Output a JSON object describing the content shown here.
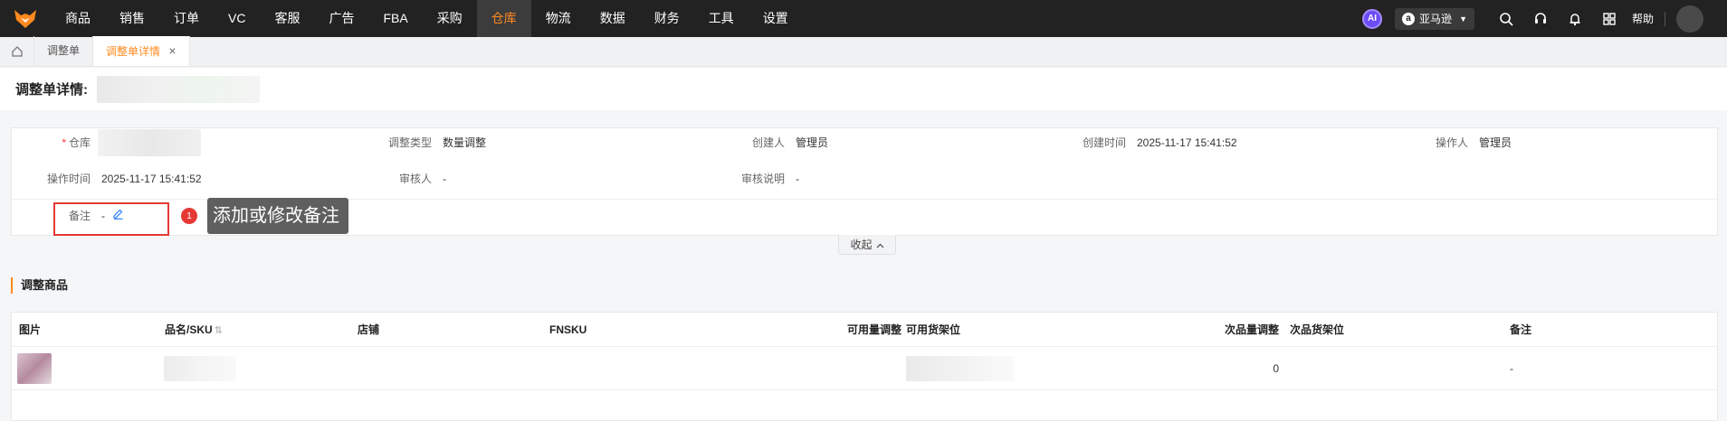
{
  "nav": {
    "menu": [
      "商品",
      "销售",
      "订单",
      "VC",
      "客服",
      "广告",
      "FBA",
      "采购",
      "仓库",
      "物流",
      "数据",
      "财务",
      "工具",
      "设置"
    ],
    "active_index": 8,
    "ai_label": "AI",
    "site_label": "亚马逊",
    "help_label": "帮助",
    "icons": [
      "search-icon",
      "headset-icon",
      "bell-icon",
      "apps-grid-icon"
    ]
  },
  "tabs": {
    "items": [
      {
        "label": "调整单",
        "active": false
      },
      {
        "label": "调整单详情",
        "active": true
      }
    ]
  },
  "header": {
    "title": "调整单详情:"
  },
  "info": {
    "warehouse_label": "仓库",
    "adjust_type_label": "调整类型",
    "adjust_type_value": "数量调整",
    "creator_label": "创建人",
    "creator_value": "管理员",
    "create_time_label": "创建时间",
    "create_time_value": "2025-11-17 15:41:52",
    "operator_label": "操作人",
    "operator_value": "管理员",
    "op_time_label": "操作时间",
    "op_time_value": "2025-11-17 15:41:52",
    "reviewer_label": "审核人",
    "reviewer_value": "-",
    "review_note_label": "审核说明",
    "review_note_value": "-",
    "remark_label": "备注",
    "remark_value": "-"
  },
  "annotation": {
    "number": "1",
    "text": "添加或修改备注"
  },
  "collapse_label": "收起",
  "section": {
    "title": "调整商品"
  },
  "table": {
    "columns": [
      "图片",
      "品名/SKU",
      "店铺",
      "FNSKU",
      "可用量调整",
      "可用货架位",
      "次品量调整",
      "次品货架位",
      "备注"
    ],
    "rows": [
      {
        "defect_qty": "0",
        "remark": "-"
      }
    ]
  }
}
